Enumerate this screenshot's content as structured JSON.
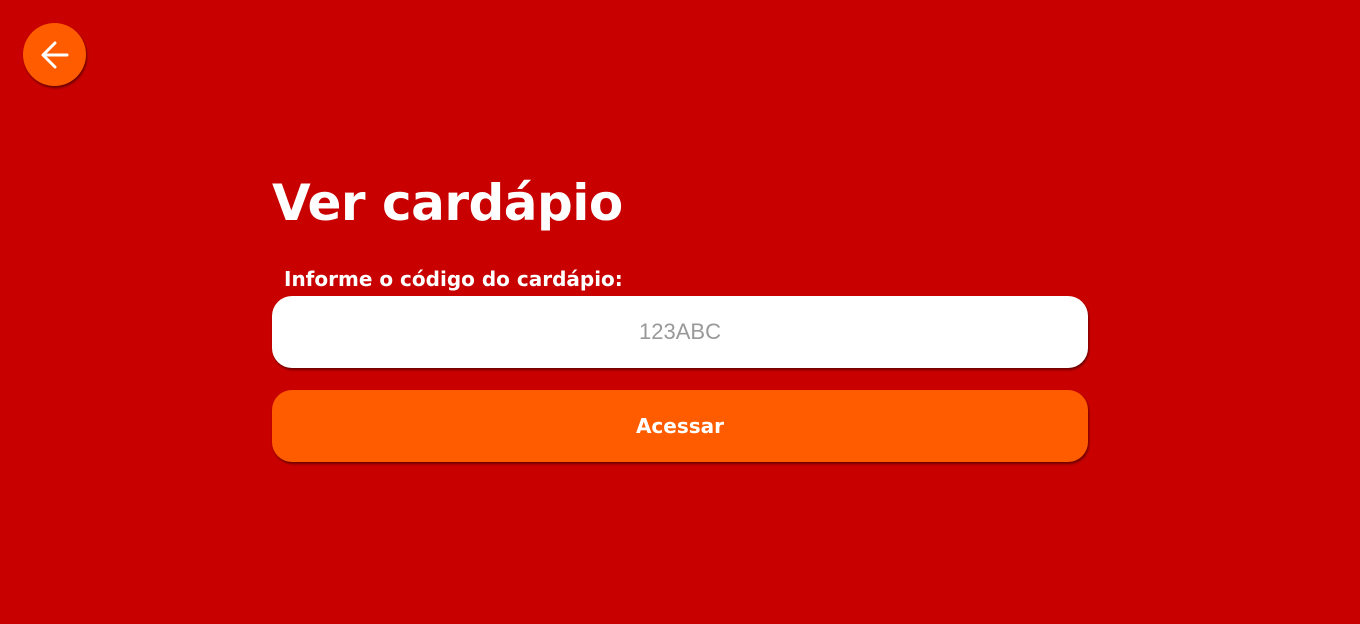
{
  "colors": {
    "background": "#c80000",
    "accent": "#ff5c00",
    "input_background": "#ffffff",
    "text": "#ffffff",
    "placeholder": "#999999"
  },
  "header": {
    "back_icon": "arrow-left-icon"
  },
  "main": {
    "title": "Ver cardápio",
    "code_label": "Informe o código do cardápio:",
    "code_input": {
      "value": "",
      "placeholder": "123ABC"
    },
    "submit_label": "Acessar"
  }
}
